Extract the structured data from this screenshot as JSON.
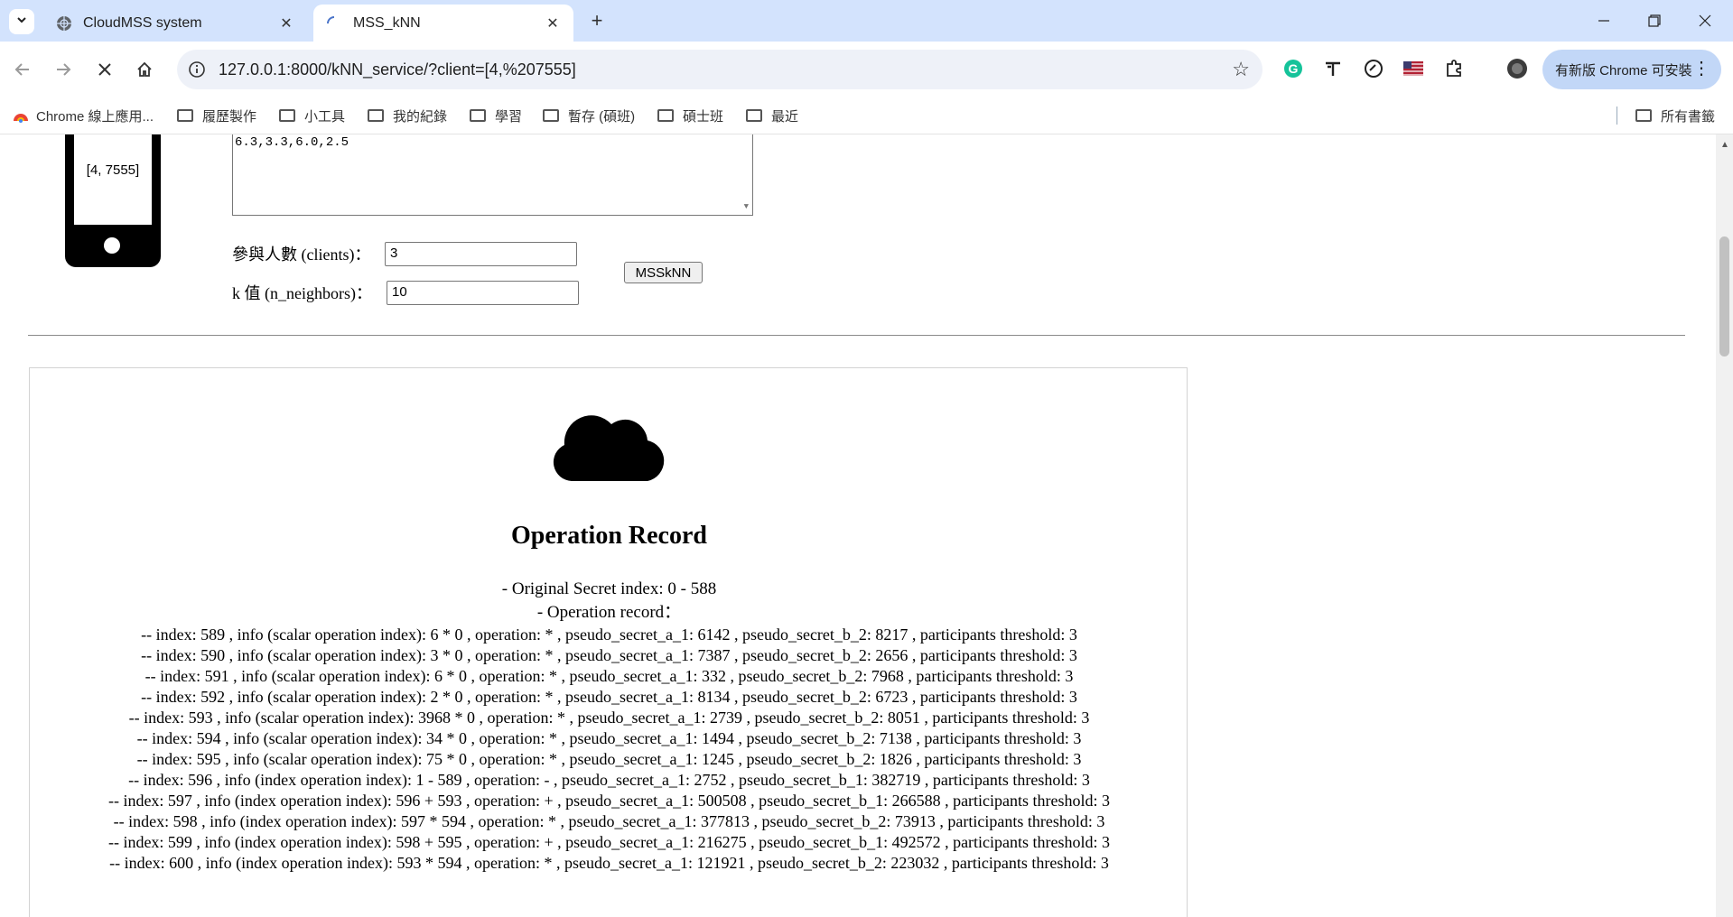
{
  "browser": {
    "tabs": [
      {
        "title": "CloudMSS system",
        "active": false
      },
      {
        "title": "MSS_kNN",
        "active": true
      }
    ],
    "url": "127.0.0.1:8000/kNN_service/?client=[4,%207555]",
    "update_button": "有新版 Chrome 可安裝",
    "bookmarks": [
      "Chrome 線上應用...",
      "履歷製作",
      "小工具",
      "我的紀錄",
      "學習",
      "暫存 (碩班)",
      "碩士班",
      "最近"
    ],
    "all_bookmarks": "所有書籤"
  },
  "client": {
    "device_label": "[4, 7555]"
  },
  "form": {
    "textarea_value": "6.3,3.3,6.0,2.5",
    "clients_label": "參與人數 (clients)：",
    "clients_value": "3",
    "k_label": "k 值 (n_neighbors)：",
    "k_value": "10",
    "submit_label": "MSSkNN"
  },
  "record": {
    "title": "Operation Record",
    "original_secret": "- Original Secret index: 0 - 588",
    "operation_header": "- Operation record：",
    "lines": [
      "-- index: 589 , info (scalar operation index): 6 * 0 , operation: * , pseudo_secret_a_1: 6142 , pseudo_secret_b_2: 8217 , participants threshold: 3",
      "-- index: 590 , info (scalar operation index): 3 * 0 , operation: * , pseudo_secret_a_1: 7387 , pseudo_secret_b_2: 2656 , participants threshold: 3",
      "-- index: 591 , info (scalar operation index): 6 * 0 , operation: * , pseudo_secret_a_1: 332 , pseudo_secret_b_2: 7968 , participants threshold: 3",
      "-- index: 592 , info (scalar operation index): 2 * 0 , operation: * , pseudo_secret_a_1: 8134 , pseudo_secret_b_2: 6723 , participants threshold: 3",
      "-- index: 593 , info (scalar operation index): 3968 * 0 , operation: * , pseudo_secret_a_1: 2739 , pseudo_secret_b_2: 8051 , participants threshold: 3",
      "-- index: 594 , info (scalar operation index): 34 * 0 , operation: * , pseudo_secret_a_1: 1494 , pseudo_secret_b_2: 7138 , participants threshold: 3",
      "-- index: 595 , info (scalar operation index): 75 * 0 , operation: * , pseudo_secret_a_1: 1245 , pseudo_secret_b_2: 1826 , participants threshold: 3",
      "-- index: 596 , info (index operation index): 1 - 589 , operation: - , pseudo_secret_a_1: 2752 , pseudo_secret_b_1: 382719 , participants threshold: 3",
      "-- index: 597 , info (index operation index): 596 + 593 , operation: + , pseudo_secret_a_1: 500508 , pseudo_secret_b_1: 266588 , participants threshold: 3",
      "-- index: 598 , info (index operation index): 597 * 594 , operation: * , pseudo_secret_a_1: 377813 , pseudo_secret_b_2: 73913 , participants threshold: 3",
      "-- index: 599 , info (index operation index): 598 + 595 , operation: + , pseudo_secret_a_1: 216275 , pseudo_secret_b_1: 492572 , participants threshold: 3",
      "-- index: 600 , info (index operation index): 593 * 594 , operation: * , pseudo_secret_a_1: 121921 , pseudo_secret_b_2: 223032 , participants threshold: 3"
    ]
  },
  "colors": {
    "tabstrip": "#d3e3fd",
    "omnibox": "#eef1f8",
    "update_button": "#c2d7f7"
  }
}
